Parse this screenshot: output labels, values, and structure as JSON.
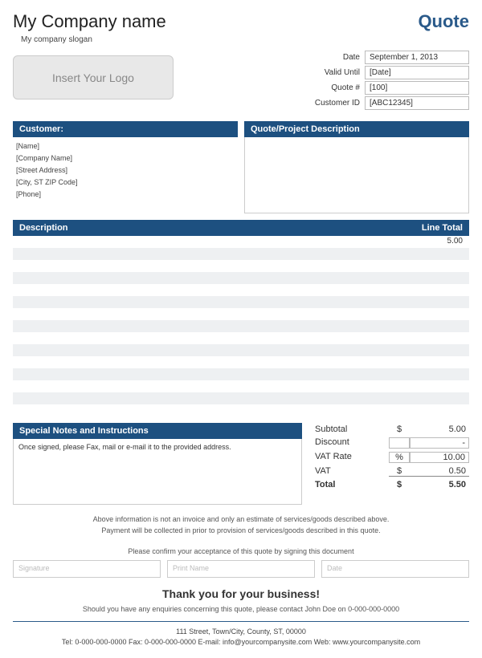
{
  "header": {
    "company_name": "My Company name",
    "slogan": "My company slogan",
    "quote_title": "Quote",
    "logo_placeholder": "Insert Your Logo"
  },
  "meta": {
    "date_label": "Date",
    "date_value": "September 1, 2013",
    "valid_label": "Valid Until",
    "valid_value": "[Date]",
    "quote_num_label": "Quote #",
    "quote_num_value": "[100]",
    "customer_id_label": "Customer ID",
    "customer_id_value": "[ABC12345]"
  },
  "customer": {
    "header": "Customer:",
    "name": "[Name]",
    "company": "[Company Name]",
    "street": "[Street Address]",
    "city": "[City, ST  ZIP Code]",
    "phone": "[Phone]"
  },
  "project": {
    "header": "Quote/Project Description"
  },
  "lines": {
    "desc_header": "Description",
    "total_header": "Line Total",
    "rows": [
      {
        "desc": "",
        "total": "5.00"
      },
      {
        "desc": "",
        "total": ""
      },
      {
        "desc": "",
        "total": ""
      },
      {
        "desc": "",
        "total": ""
      },
      {
        "desc": "",
        "total": ""
      },
      {
        "desc": "",
        "total": ""
      },
      {
        "desc": "",
        "total": ""
      },
      {
        "desc": "",
        "total": ""
      },
      {
        "desc": "",
        "total": ""
      },
      {
        "desc": "",
        "total": ""
      },
      {
        "desc": "",
        "total": ""
      },
      {
        "desc": "",
        "total": ""
      },
      {
        "desc": "",
        "total": ""
      },
      {
        "desc": "",
        "total": ""
      },
      {
        "desc": "",
        "total": ""
      }
    ]
  },
  "notes": {
    "header": "Special Notes and Instructions",
    "body": "Once signed, please Fax, mail or e-mail it to the provided address."
  },
  "totals": {
    "subtotal_label": "Subtotal",
    "subtotal_sym": "$",
    "subtotal_val": "5.00",
    "discount_label": "Discount",
    "discount_sym": "",
    "discount_val": "-",
    "vatrate_label": "VAT Rate",
    "vatrate_sym": "%",
    "vatrate_val": "10.00",
    "vat_label": "VAT",
    "vat_sym": "$",
    "vat_val": "0.50",
    "total_label": "Total",
    "total_sym": "$",
    "total_val": "5.50"
  },
  "disclaimer": {
    "line1": "Above information is not an invoice and only an estimate of services/goods described above.",
    "line2": "Payment will be collected in prior to provision of services/goods described in this quote."
  },
  "confirm": "Please confirm your acceptance of this quote by signing this document",
  "signatures": {
    "sig": "Signature",
    "print": "Print Name",
    "date": "Date"
  },
  "thanks": "Thank you for your business!",
  "enquiry": "Should you have any enquiries concerning this quote, please contact John Doe on 0-000-000-0000",
  "footer": {
    "address": "111 Street, Town/City, County, ST, 00000",
    "contact": "Tel: 0-000-000-0000 Fax: 0-000-000-0000 E-mail: info@yourcompanysite.com Web: www.yourcompanysite.com"
  }
}
